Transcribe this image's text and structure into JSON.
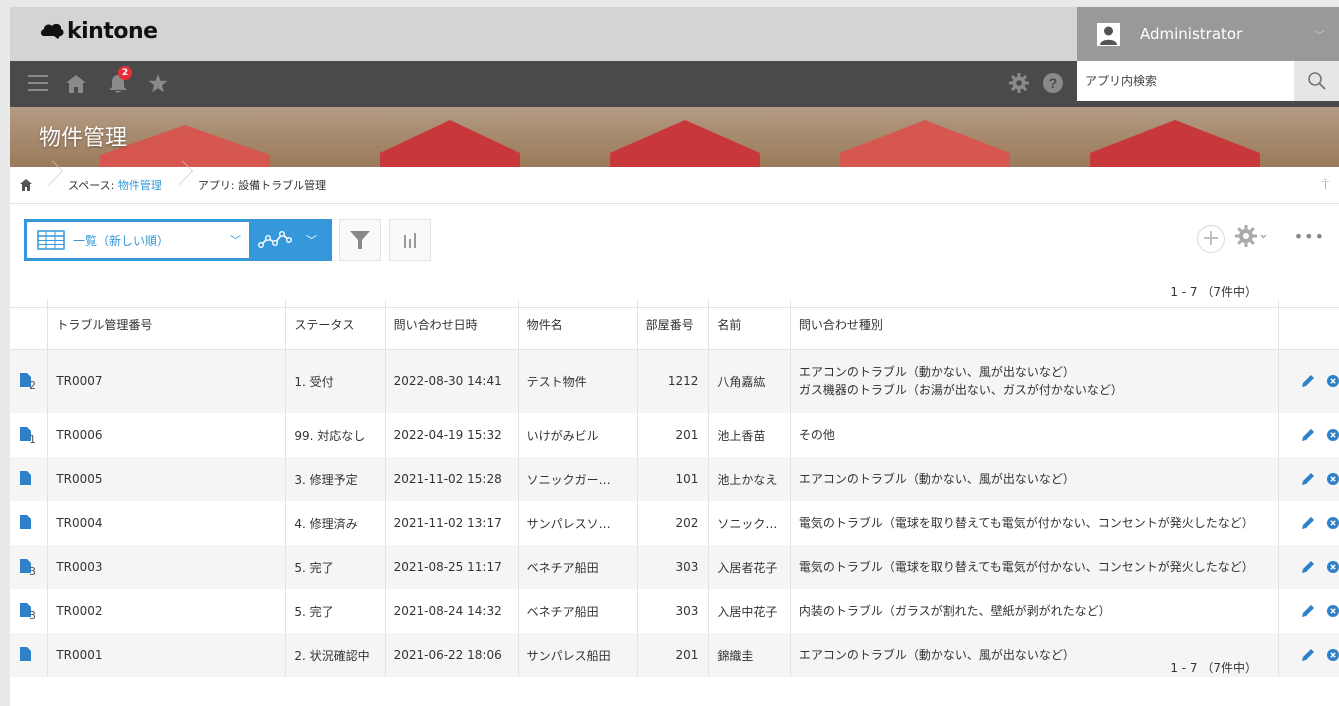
{
  "app": {
    "logo_text": "kintone"
  },
  "user": {
    "name": "Administrator"
  },
  "nav": {
    "notification_count": "2",
    "search_placeholder": "アプリ内検索"
  },
  "banner": {
    "title": "物件管理"
  },
  "breadcrumb": {
    "space_prefix": "スペース: ",
    "space_name": "物件管理",
    "app_label": "アプリ: 設備トラブル管理"
  },
  "toolbar": {
    "view_name": "一覧（新しい順）",
    "pager_top": "1 - 7 （7件中）",
    "pager_bottom": "1 - 7 （7件中）"
  },
  "colors": {
    "accent": "#3498db",
    "delete": "#3498db"
  },
  "table": {
    "headers": [
      "トラブル管理番号",
      "ステータス",
      "問い合わせ日時",
      "物件名",
      "部屋番号",
      "名前",
      "問い合わせ種別"
    ],
    "rows": [
      {
        "icon": "2",
        "id": "TR0007",
        "status": "1. 受付",
        "datetime": "2022-08-30 14:41",
        "property": "テスト物件",
        "room": "1212",
        "name": "八角嘉紘",
        "type": "エアコンのトラブル（動かない、風が出ないなど）",
        "type2": "ガス機器のトラブル（お湯が出ない、ガスが付かないなど）"
      },
      {
        "icon": "1",
        "id": "TR0006",
        "status": "99. 対応なし",
        "datetime": "2022-04-19 15:32",
        "property": "いけがみビル",
        "room": "201",
        "name": "池上香苗",
        "type": "その他",
        "type2": ""
      },
      {
        "icon": "",
        "id": "TR0005",
        "status": "3. 修理予定",
        "datetime": "2021-11-02 15:28",
        "property": "ソニックガー…",
        "room": "101",
        "name": "池上かなえ",
        "type": "エアコンのトラブル（動かない、風が出ないなど）",
        "type2": ""
      },
      {
        "icon": "",
        "id": "TR0004",
        "status": "4. 修理済み",
        "datetime": "2021-11-02 13:17",
        "property": "サンパレスソ…",
        "room": "202",
        "name": "ソニック…",
        "type": "電気のトラブル（電球を取り替えても電気が付かない、コンセントが発火したなど）",
        "type2": ""
      },
      {
        "icon": "3",
        "id": "TR0003",
        "status": "5. 完了",
        "datetime": "2021-08-25 11:17",
        "property": "ベネチア船田",
        "room": "303",
        "name": "入居者花子",
        "type": "電気のトラブル（電球を取り替えても電気が付かない、コンセントが発火したなど）",
        "type2": ""
      },
      {
        "icon": "3",
        "id": "TR0002",
        "status": "5. 完了",
        "datetime": "2021-08-24 14:32",
        "property": "ベネチア船田",
        "room": "303",
        "name": "入居中花子",
        "type": "内装のトラブル（ガラスが割れた、壁紙が剥がれたなど）",
        "type2": ""
      },
      {
        "icon": "",
        "id": "TR0001",
        "status": "2. 状況確認中",
        "datetime": "2021-06-22 18:06",
        "property": "サンパレス船田",
        "room": "201",
        "name": "錦織圭",
        "type": "エアコンのトラブル（動かない、風が出ないなど）",
        "type2": ""
      }
    ]
  }
}
